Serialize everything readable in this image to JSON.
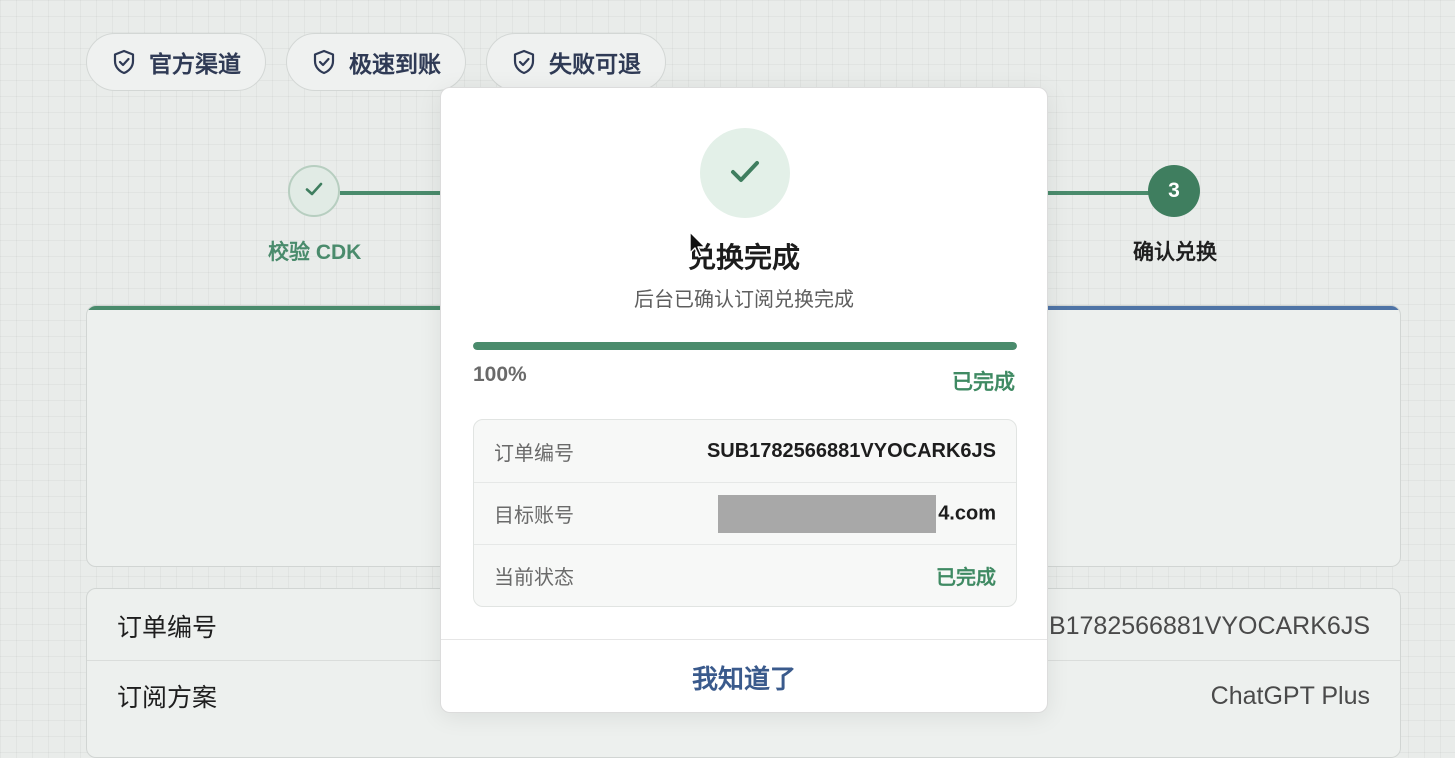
{
  "badges": [
    {
      "label": "官方渠道",
      "icon": "shield-check-icon"
    },
    {
      "label": "极速到账",
      "icon": "shield-check-icon"
    },
    {
      "label": "失败可退",
      "icon": "shield-check-icon"
    }
  ],
  "stepper": {
    "step1_label": "校验 CDK",
    "step3_number": "3",
    "step3_label": "确认兑换"
  },
  "order_card": {
    "order_no_label": "订单编号",
    "order_no_value": "SUB1782566881VYOCARK6JS",
    "plan_label": "订阅方案",
    "plan_value": "ChatGPT Plus"
  },
  "modal": {
    "title": "兑换完成",
    "subtitle": "后台已确认订阅兑换完成",
    "progress_percent": 100,
    "progress_text": "100%",
    "progress_status": "已完成",
    "rows": [
      {
        "label": "订单编号",
        "value": "SUB1782566881VYOCARK6JS"
      },
      {
        "label": "目标账号",
        "value": "4.com"
      },
      {
        "label": "当前状态",
        "value": "已完成"
      }
    ],
    "confirm_label": "我知道了"
  },
  "colors": {
    "accent_green": "#4a8b6c",
    "status_green": "#3f8a63",
    "link_blue": "#3a5a8c",
    "accent_blue": "#4f74a6"
  }
}
